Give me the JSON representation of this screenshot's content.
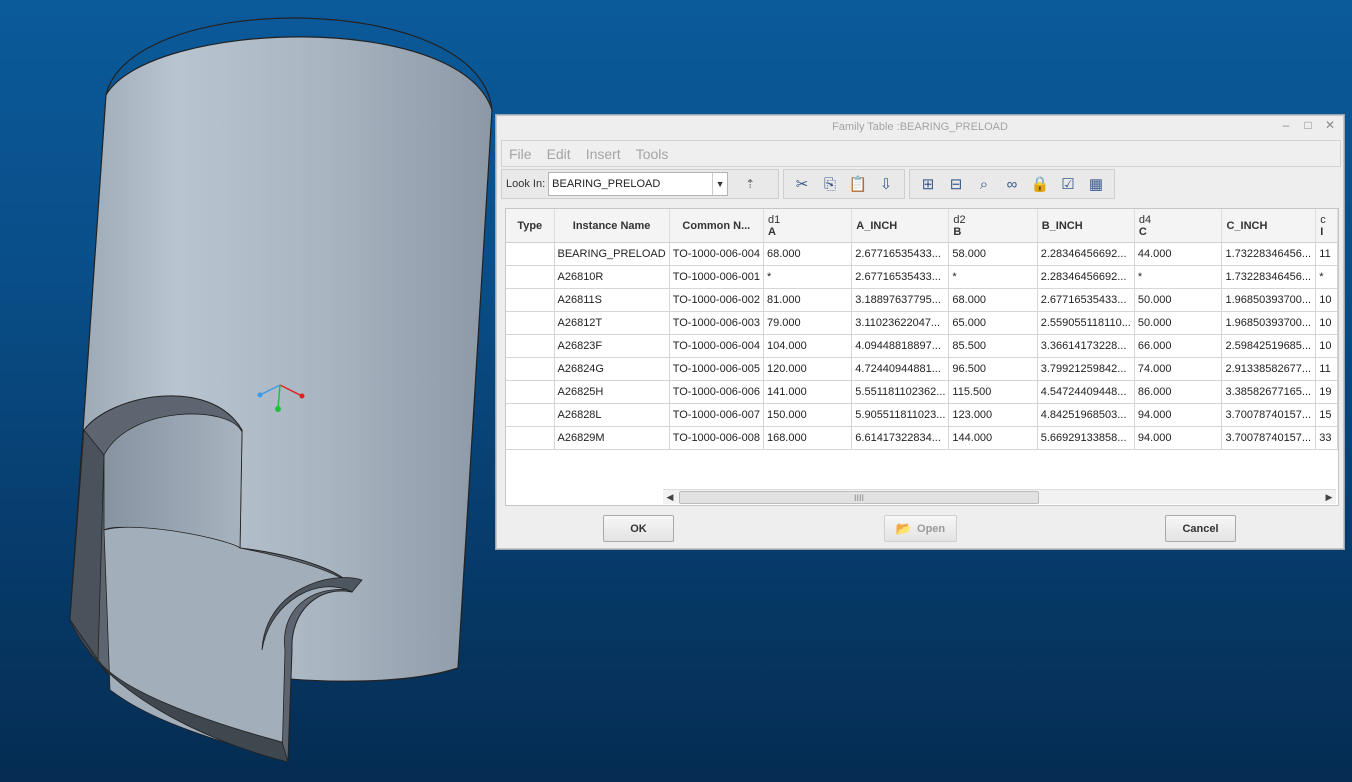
{
  "dialog": {
    "title": "Family Table :BEARING_PRELOAD",
    "window_controls": {
      "minimize": "‒",
      "maximize": "□",
      "close": "✕"
    },
    "menu": [
      "File",
      "Edit",
      "Insert",
      "Tools"
    ],
    "look_in": {
      "label": "Look In:",
      "value": "BEARING_PRELOAD"
    },
    "toolbar_icons": [
      "up-folder-icon",
      "cut-icon",
      "copy-icon",
      "paste-icon",
      "paste-special-icon",
      "add-column-icon",
      "insert-instance-icon",
      "find-icon",
      "verify-icon",
      "lock-icon",
      "check-icon",
      "table-view-icon"
    ],
    "columns": [
      {
        "line1": "",
        "line2": "Type"
      },
      {
        "line1": "",
        "line2": "Instance Name"
      },
      {
        "line1": "",
        "line2": "Common N..."
      },
      {
        "line1": "d1",
        "line2": "A"
      },
      {
        "line1": "",
        "line2": "A_INCH"
      },
      {
        "line1": "d2",
        "line2": "B"
      },
      {
        "line1": "",
        "line2": "B_INCH"
      },
      {
        "line1": "d4",
        "line2": "C"
      },
      {
        "line1": "",
        "line2": "C_INCH"
      },
      {
        "line1": "c",
        "line2": "I"
      }
    ],
    "rows": [
      [
        "",
        "BEARING_PRELOAD",
        "TO-1000-006-004",
        "68.000",
        "2.67716535433...",
        "58.000",
        "2.28346456692...",
        "44.000",
        "1.73228346456...",
        "11"
      ],
      [
        "",
        "A26810R",
        "TO-1000-006-001",
        "*",
        "2.67716535433...",
        "*",
        "2.28346456692...",
        "*",
        "1.73228346456...",
        "*"
      ],
      [
        "",
        "A26811S",
        "TO-1000-006-002",
        "81.000",
        "3.18897637795...",
        "68.000",
        "2.67716535433...",
        "50.000",
        "1.96850393700...",
        "10"
      ],
      [
        "",
        "A26812T",
        "TO-1000-006-003",
        "79.000",
        "3.11023622047...",
        "65.000",
        "2.559055118110...",
        "50.000",
        "1.96850393700...",
        "10"
      ],
      [
        "",
        "A26823F",
        "TO-1000-006-004",
        "104.000",
        "4.09448818897...",
        "85.500",
        "3.36614173228...",
        "66.000",
        "2.59842519685...",
        "10"
      ],
      [
        "",
        "A26824G",
        "TO-1000-006-005",
        "120.000",
        "4.72440944881...",
        "96.500",
        "3.79921259842...",
        "74.000",
        "2.91338582677...",
        "11"
      ],
      [
        "",
        "A26825H",
        "TO-1000-006-006",
        "141.000",
        "5.551181102362...",
        "115.500",
        "4.54724409448...",
        "86.000",
        "3.38582677165...",
        "19"
      ],
      [
        "",
        "A26828L",
        "TO-1000-006-007",
        "150.000",
        "5.905511811023...",
        "123.000",
        "4.84251968503...",
        "94.000",
        "3.70078740157...",
        "15"
      ],
      [
        "",
        "A26829M",
        "TO-1000-006-008",
        "168.000",
        "6.61417322834...",
        "144.000",
        "5.66929133858...",
        "94.000",
        "3.70078740157...",
        "33"
      ]
    ],
    "scroll_thumb": "IIII",
    "buttons": {
      "ok": "OK",
      "open": "Open",
      "cancel": "Cancel"
    }
  }
}
